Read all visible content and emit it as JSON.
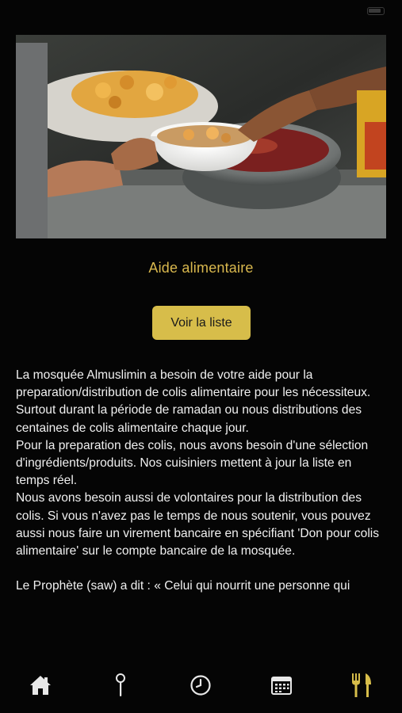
{
  "status_bar": {
    "time": "",
    "carrier": ""
  },
  "content": {
    "title": "Aide alimentaire",
    "button_label": "Voir la liste",
    "hero_alt": "",
    "body": "La mosquée Almuslimin a besoin de votre aide pour la preparation/distribution de colis alimentaire pour les nécessiteux.\nSurtout durant la période de ramadan ou nous distributions des centaines de colis alimentaire chaque jour.\nPour la preparation des colis, nous avons besoin d'une sélection d'ingrédients/produits. Nos cuisiniers mettent à jour la liste en temps réel.\nNous avons besoin aussi de volontaires pour la distribution des colis. Si vous n'avez pas le temps de nous soutenir, vous pouvez\naussi nous faire un virement bancaire en spécifiant 'Don pour colis alimentaire' sur le compte bancaire de la mosquée.\n\nLe Prophète (saw) a dit : « Celui qui nourrit une personne qui"
  },
  "tab_bar": {
    "items": [
      {
        "icon": "home-icon",
        "active": false
      },
      {
        "icon": "pin-icon",
        "active": false
      },
      {
        "icon": "clock-icon",
        "active": false
      },
      {
        "icon": "calendar-icon",
        "active": false
      },
      {
        "icon": "fork-knife-icon",
        "active": true
      }
    ],
    "active_color": "#d7bd4a",
    "inactive_color": "#e8e8e8"
  },
  "colors": {
    "accent": "#d7bd4a",
    "background": "#050505",
    "text": "#f0f0f0"
  }
}
